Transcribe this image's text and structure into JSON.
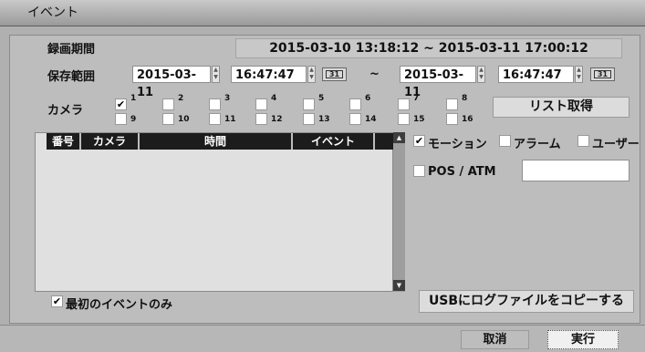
{
  "window": {
    "title": "イベント"
  },
  "record_period": {
    "label": "録画期間",
    "value": "2015-03-10 13:18:12 ~ 2015-03-11 17:00:12"
  },
  "save_range": {
    "label": "保存範囲",
    "start_date": "2015-03-11",
    "start_time": "16:47:47",
    "separator": "~",
    "end_date": "2015-03-11",
    "end_time": "16:47:47",
    "calendar_day": "31"
  },
  "camera": {
    "label": "カメラ",
    "items": [
      {
        "num": "1",
        "checked": true
      },
      {
        "num": "2",
        "checked": false
      },
      {
        "num": "3",
        "checked": false
      },
      {
        "num": "4",
        "checked": false
      },
      {
        "num": "5",
        "checked": false
      },
      {
        "num": "6",
        "checked": false
      },
      {
        "num": "7",
        "checked": false
      },
      {
        "num": "8",
        "checked": false
      },
      {
        "num": "9",
        "checked": false
      },
      {
        "num": "10",
        "checked": false
      },
      {
        "num": "11",
        "checked": false
      },
      {
        "num": "12",
        "checked": false
      },
      {
        "num": "13",
        "checked": false
      },
      {
        "num": "14",
        "checked": false
      },
      {
        "num": "15",
        "checked": false
      },
      {
        "num": "16",
        "checked": false
      }
    ]
  },
  "get_list_button": "リスト取得",
  "table": {
    "headers": [
      "番号",
      "カメラ",
      "時間",
      "イベント",
      ""
    ]
  },
  "filters": {
    "motion": {
      "label": "モーション",
      "checked": true
    },
    "alarm": {
      "label": "アラーム",
      "checked": false
    },
    "user": {
      "label": "ユーザー",
      "checked": false
    },
    "pos_atm": {
      "label": "POS / ATM",
      "checked": false
    },
    "pos_text": ""
  },
  "first_event_only": {
    "label": "最初のイベントのみ",
    "checked": true
  },
  "usb_copy_button": "USBにログファイルをコピーする",
  "footer": {
    "cancel": "取消",
    "execute": "実行"
  },
  "check_glyph": "✔",
  "colors": {
    "title_bar": "#a8a8a8",
    "panel": "#bdbdbd",
    "list_header": "#1c1c1c"
  }
}
